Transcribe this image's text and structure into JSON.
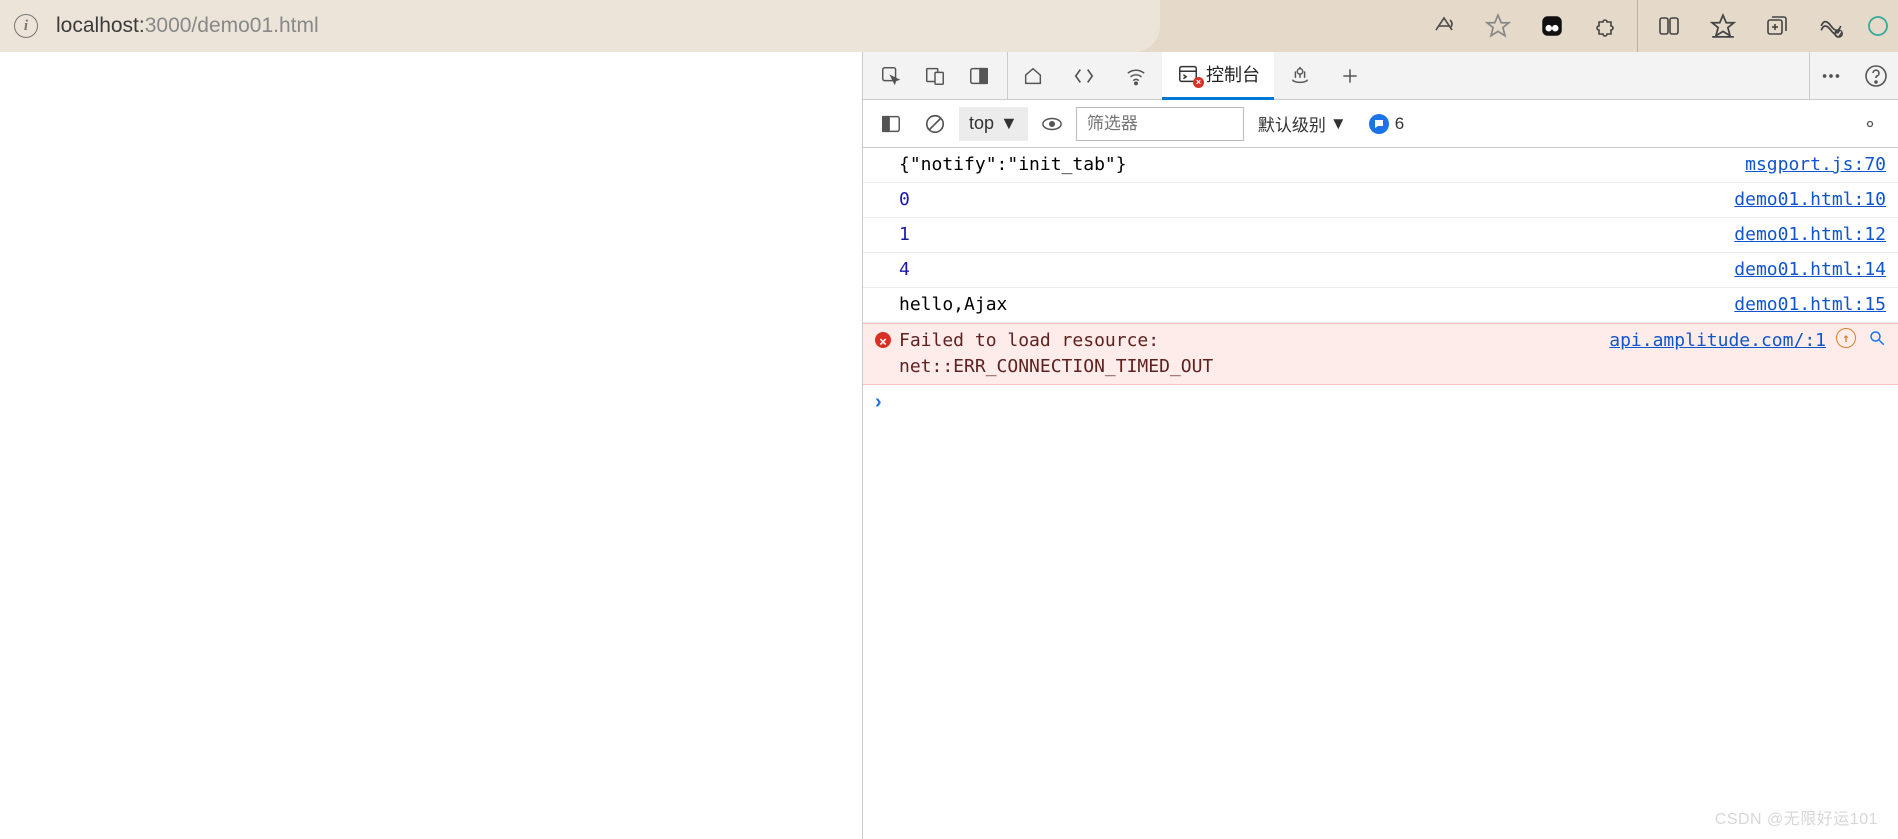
{
  "address_bar": {
    "host": "localhost:",
    "port_path": "3000/demo01.html"
  },
  "devtools": {
    "tabs": {
      "console_label": "控制台"
    },
    "toolbar": {
      "context": "top",
      "filter_placeholder": "筛选器",
      "level_label": "默认级别",
      "issues_count": "6"
    },
    "logs": [
      {
        "msg": "{\"notify\":\"init_tab\"}",
        "src": "msgport.js:70",
        "kind": "obj"
      },
      {
        "msg": "0",
        "src": "demo01.html:10",
        "kind": "num"
      },
      {
        "msg": "1",
        "src": "demo01.html:12",
        "kind": "num"
      },
      {
        "msg": "4",
        "src": "demo01.html:14",
        "kind": "num"
      },
      {
        "msg": "hello,Ajax",
        "src": "demo01.html:15",
        "kind": "txt"
      },
      {
        "msg": "Failed to load resource:\nnet::ERR_CONNECTION_TIMED_OUT",
        "src": "api.amplitude.com/:1",
        "kind": "err"
      }
    ]
  },
  "watermark": "CSDN @无限好运101"
}
